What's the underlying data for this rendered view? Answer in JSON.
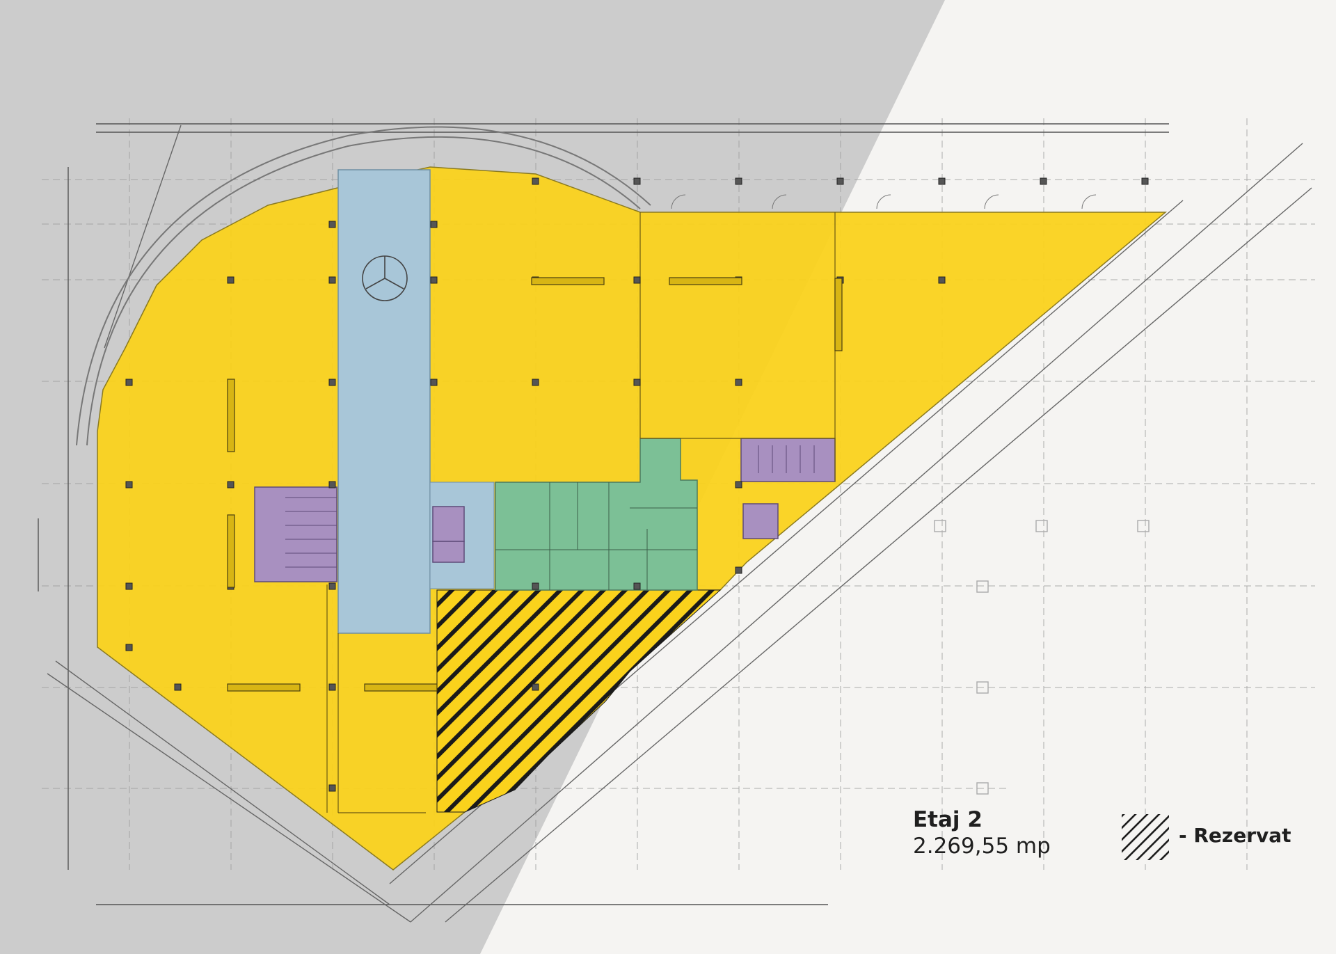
{
  "floor": {
    "name": "Etaj 2",
    "area": "2.269,55 mp"
  },
  "legend": {
    "reserved_label": "- Rezervat"
  },
  "colors": {
    "rentable_area": "#fad21c",
    "circulation_corridor": "#a8c6d8",
    "stairs_shafts": "#a890c0",
    "services_core": "#7cc096",
    "reserved_hatch": "#1a1a1a",
    "background_left": "#cccccc",
    "background_right": "#f5f4f2"
  }
}
